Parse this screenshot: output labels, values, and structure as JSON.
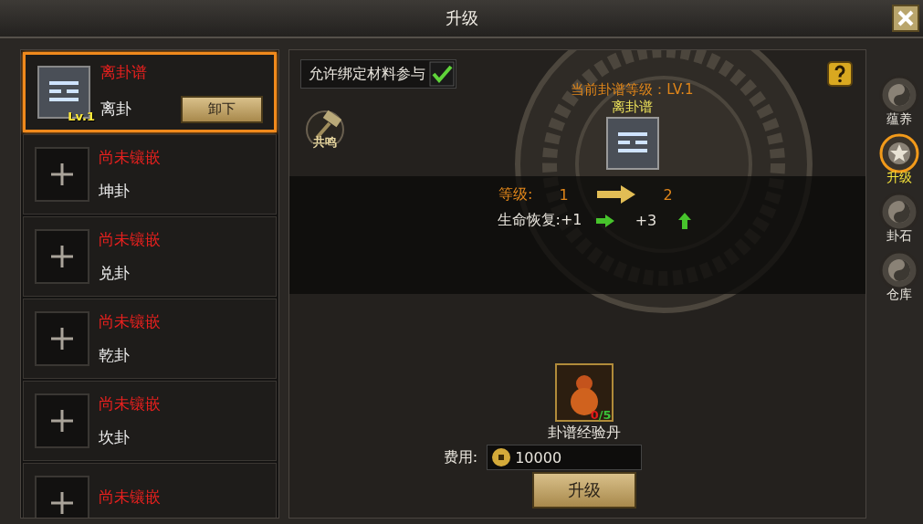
{
  "window": {
    "title": "升级"
  },
  "slots": [
    {
      "kind": "filled",
      "selected": true,
      "title": "离卦谱",
      "name": "离卦",
      "level": "Lv.1",
      "button": "卸下"
    },
    {
      "kind": "empty",
      "selected": false,
      "title": "尚未镶嵌",
      "name": "坤卦"
    },
    {
      "kind": "empty",
      "selected": false,
      "title": "尚未镶嵌",
      "name": "兑卦"
    },
    {
      "kind": "empty",
      "selected": false,
      "title": "尚未镶嵌",
      "name": "乾卦"
    },
    {
      "kind": "empty",
      "selected": false,
      "title": "尚未镶嵌",
      "name": "坎卦"
    },
    {
      "kind": "empty",
      "selected": false,
      "title": "尚未镶嵌"
    }
  ],
  "bind_option": {
    "label": "允许绑定材料参与",
    "checked": true
  },
  "resonance": {
    "label": "共鸣"
  },
  "current": {
    "level_text": "当前卦谱等级：LV.1",
    "item_name": "离卦谱"
  },
  "level_row": {
    "label": "等级:",
    "from": "1",
    "to": "2"
  },
  "stats": [
    {
      "label": "生命恢复:+1",
      "next": "+3"
    }
  ],
  "material": {
    "name": "卦谱经验丹",
    "have": "0",
    "rest": "/5"
  },
  "cost": {
    "label": "费用:",
    "value": "10000"
  },
  "upgrade_button": "升级",
  "side_tabs": [
    {
      "label": "蕴养",
      "selected": false
    },
    {
      "label": "升级",
      "selected": true
    },
    {
      "label": "卦石",
      "selected": false
    },
    {
      "label": "仓库",
      "selected": false
    }
  ]
}
